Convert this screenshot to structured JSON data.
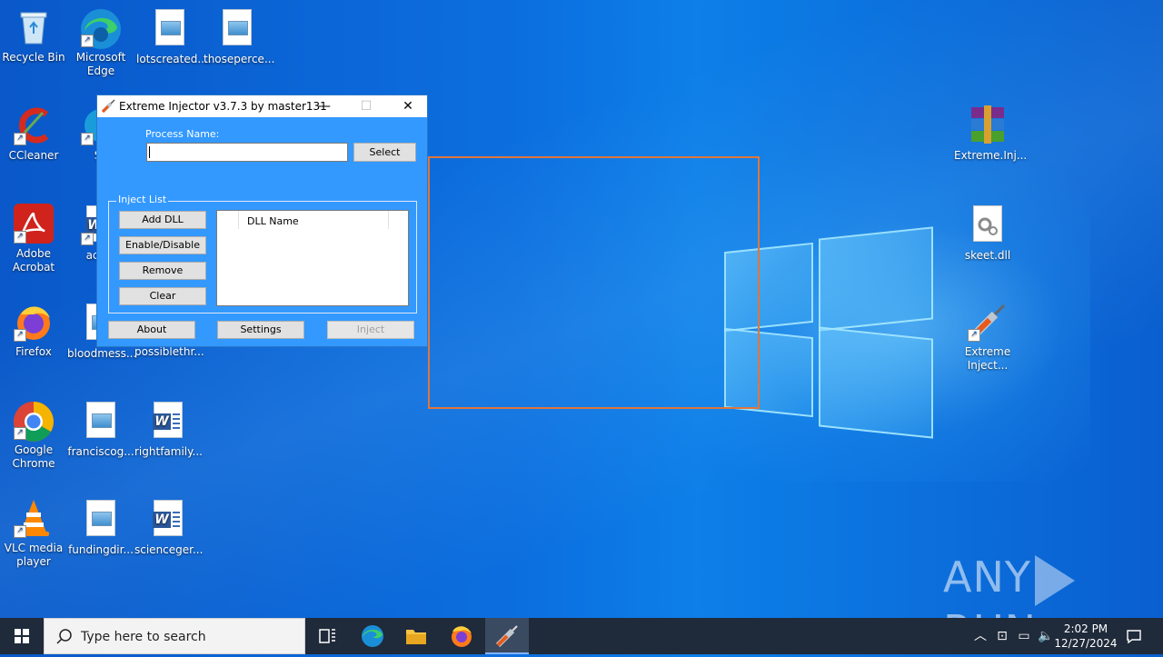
{
  "desktop": {
    "icons": [
      {
        "label": "Recycle Bin"
      },
      {
        "label": "Microsoft Edge"
      },
      {
        "label": "lotscreated...."
      },
      {
        "label": "thoseperce..."
      },
      {
        "label": "CCleaner"
      },
      {
        "label": "Sk"
      },
      {
        "label": "Adobe Acrobat"
      },
      {
        "label": "accor"
      },
      {
        "label": "Firefox"
      },
      {
        "label": "bloodmess..."
      },
      {
        "label": "possiblethr..."
      },
      {
        "label": "Google Chrome"
      },
      {
        "label": "franciscog..."
      },
      {
        "label": "rightfamily..."
      },
      {
        "label": "VLC media player"
      },
      {
        "label": "fundingdir..."
      },
      {
        "label": "scienceger..."
      },
      {
        "label": "Extreme.Inj..."
      },
      {
        "label": "skeet.dll"
      },
      {
        "label": "Extreme Inject..."
      }
    ]
  },
  "window": {
    "title": "Extreme Injector v3.7.3 by master131",
    "process_label": "Process Name:",
    "process_value": "",
    "select_label": "Select",
    "inject_list_label": "Inject List",
    "buttons": {
      "add_dll": "Add DLL",
      "enable_disable": "Enable/Disable",
      "remove": "Remove",
      "clear": "Clear",
      "about": "About",
      "settings": "Settings",
      "inject": "Inject"
    },
    "list_column": "DLL Name",
    "minimize_glyph": "—",
    "maximize_glyph": "☐",
    "close_glyph": "✕"
  },
  "watermark": {
    "left": "ANY",
    "right": "RUN"
  },
  "taskbar": {
    "search_placeholder": "Type here to search",
    "time": "2:02 PM",
    "date": "12/27/2024"
  },
  "colors": {
    "window_bg": "#3399ff",
    "selection": "#e0763a",
    "taskbar": "#1f2a3a"
  }
}
